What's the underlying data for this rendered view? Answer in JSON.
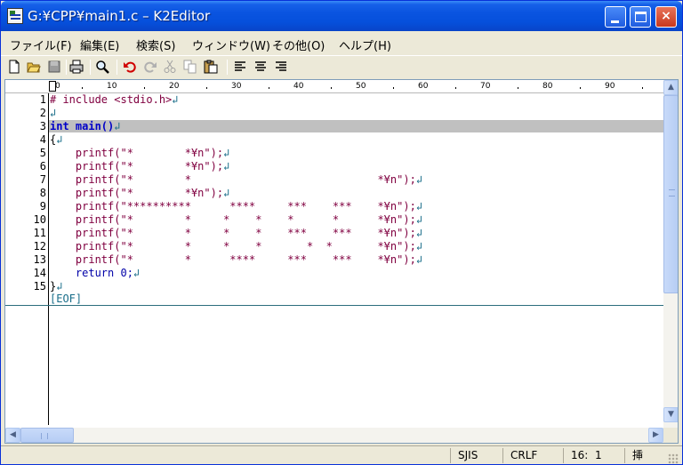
{
  "window": {
    "title": "G:¥CPP¥main1.c – K2Editor"
  },
  "titlebar": {
    "minimize": "_",
    "maximize": "□",
    "close": "×"
  },
  "menu": [
    "ファイル(F)",
    "編集(E)",
    "検索(S)",
    "ウィンドウ(W)",
    "その他(O)",
    "ヘルプ(H)"
  ],
  "toolbar": [
    "new-file",
    "open-folder",
    "save",
    "print",
    "find",
    "undo",
    "redo",
    "cut",
    "copy",
    "paste",
    "align-left",
    "align-center",
    "align-right"
  ],
  "ruler": {
    "ticks": [
      "0",
      "10",
      "20",
      "30",
      "40",
      "50",
      "60",
      "70",
      "80",
      "90"
    ]
  },
  "editor": {
    "line_numbers": [
      "1",
      "2",
      "3",
      "4",
      "5",
      "6",
      "7",
      "8",
      "9",
      "10",
      "11",
      "12",
      "13",
      "14",
      "15"
    ],
    "lines": [
      "# include <stdio.h>",
      "",
      "int main()",
      "{",
      "    printf(\"*        *¥n\");",
      "    printf(\"*        *¥n\");",
      "    printf(\"*        *                             *¥n\");",
      "    printf(\"*        *¥n\");",
      "    printf(\"**********      ****     ***    ***    *¥n\");",
      "    printf(\"*        *     *    *    *      *      *¥n\");",
      "    printf(\"*        *     *    *    ***    ***    *¥n\");",
      "    printf(\"*        *     *    *       *  *       *¥n\");",
      "    printf(\"*        *      ****     ***    ***    *¥n\");",
      "    return 0;",
      "}"
    ],
    "eof_marker": "[EOF]",
    "newline_glyph": "↲"
  },
  "status": {
    "encoding": "SJIS",
    "line_ending": "CRLF",
    "position": "16:  1",
    "mode": "挿"
  },
  "colors": {
    "keyword": "#0000c8",
    "string": "#800040",
    "newline": "#1a6e8a",
    "current_line": "#c0c0c0"
  }
}
